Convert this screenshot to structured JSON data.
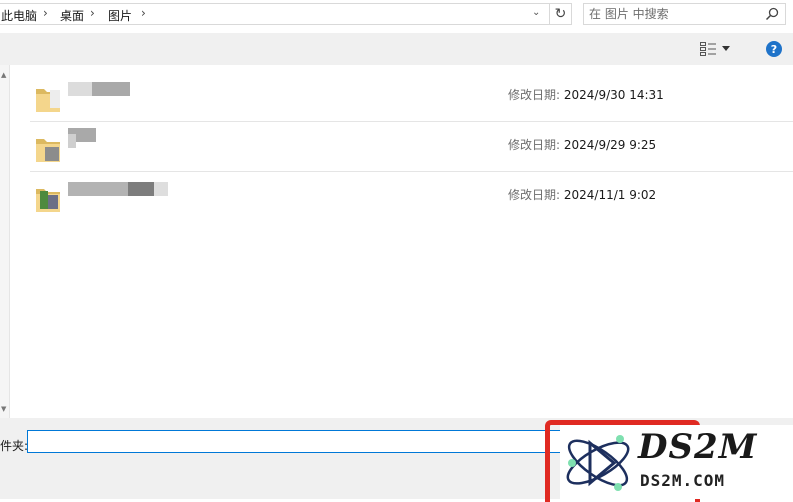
{
  "address": {
    "crumbs": [
      "此电脑",
      "桌面",
      "图片"
    ],
    "separator": "›"
  },
  "search": {
    "placeholder": "在 图片 中搜索"
  },
  "toolbar": {
    "help_label": "?"
  },
  "files": [
    {
      "modified_label": "修改日期:",
      "modified": "2024/9/30 14:31"
    },
    {
      "modified_label": "修改日期:",
      "modified": "2024/9/29 9:25"
    },
    {
      "modified_label": "修改日期:",
      "modified": "2024/11/1 9:02"
    }
  ],
  "footer": {
    "filename_label": "件夹:",
    "filename_value": ""
  },
  "watermark": {
    "logo_text": "DS2M",
    "url_text": "DS2M.COM"
  }
}
